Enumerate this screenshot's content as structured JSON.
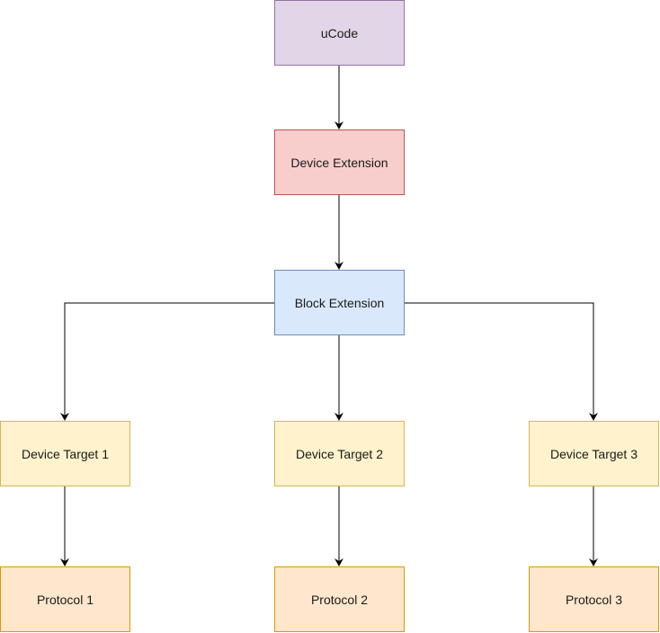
{
  "diagram": {
    "nodes": {
      "ucode": {
        "label": "uCode",
        "fill": "#e1d5e7",
        "stroke": "#9673a6"
      },
      "device_extension": {
        "label": "Device Extension",
        "fill": "#f8cecc",
        "stroke": "#b85450"
      },
      "block_extension": {
        "label": "Block Extension",
        "fill": "#dae8fc",
        "stroke": "#6c8ebf"
      },
      "device_target_1": {
        "label": "Device Target 1",
        "fill": "#fff2cc",
        "stroke": "#d6b656"
      },
      "device_target_2": {
        "label": "Device Target 2",
        "fill": "#fff2cc",
        "stroke": "#d6b656"
      },
      "device_target_3": {
        "label": "Device Target 3",
        "fill": "#fff2cc",
        "stroke": "#d6b656"
      },
      "protocol_1": {
        "label": "Protocol 1",
        "fill": "#ffe6cc",
        "stroke": "#d79b00"
      },
      "protocol_2": {
        "label": "Protocol 2",
        "fill": "#ffe6cc",
        "stroke": "#d79b00"
      },
      "protocol_3": {
        "label": "Protocol 3",
        "fill": "#ffe6cc",
        "stroke": "#d79b00"
      }
    },
    "edges": [
      {
        "from": "uCode",
        "to": "Device Extension"
      },
      {
        "from": "Device Extension",
        "to": "Block Extension"
      },
      {
        "from": "Block Extension",
        "to": "Device Target 1"
      },
      {
        "from": "Block Extension",
        "to": "Device Target 2"
      },
      {
        "from": "Block Extension",
        "to": "Device Target 3"
      },
      {
        "from": "Device Target 1",
        "to": "Protocol 1"
      },
      {
        "from": "Device Target 2",
        "to": "Protocol 2"
      },
      {
        "from": "Device Target 3",
        "to": "Protocol 3"
      }
    ]
  }
}
